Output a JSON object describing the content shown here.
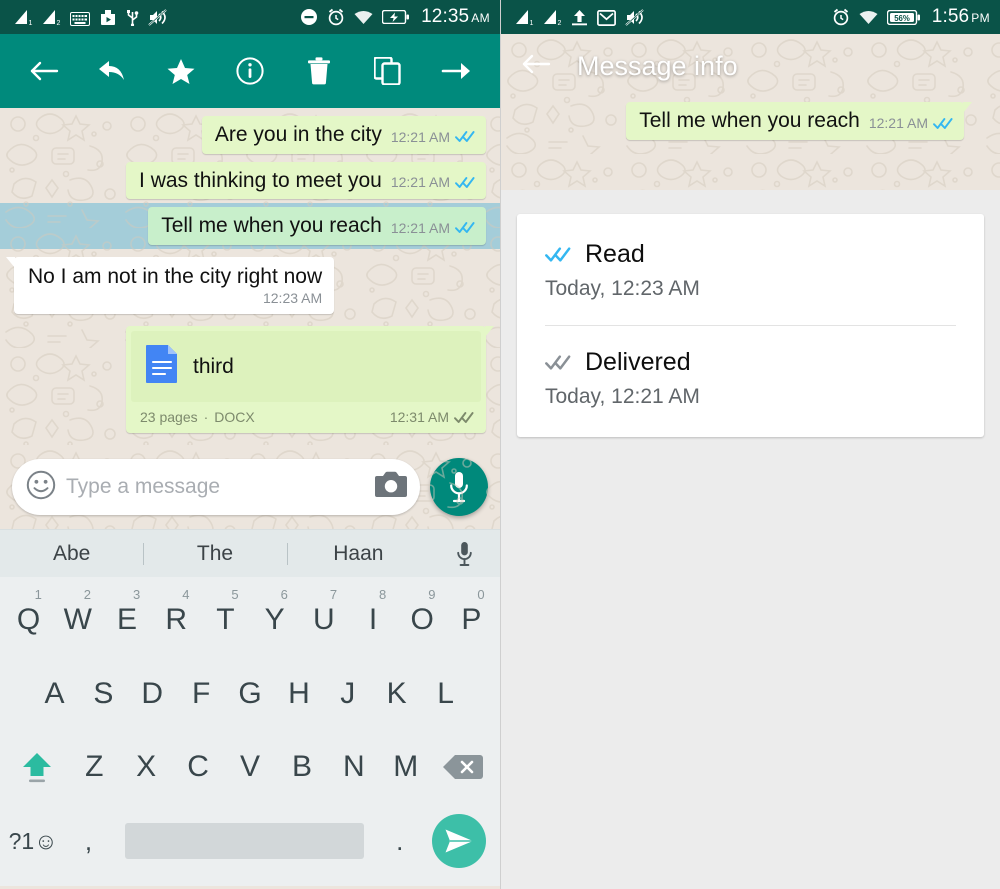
{
  "left_panel": {
    "status_bar": {
      "icons": [
        "signal-1-icon",
        "signal-2-icon",
        "keyboard-icon",
        "play-store-icon",
        "usb-icon",
        "volume-muted-icon"
      ],
      "right_icons": [
        "do-not-disturb-icon",
        "alarm-icon",
        "wifi-icon",
        "battery-charging-icon"
      ],
      "clock": "12:35",
      "ampm": "AM"
    },
    "toolbar": {
      "back_label": "back-arrow",
      "actions": [
        "reply-icon",
        "star-icon",
        "info-icon",
        "delete-icon",
        "copy-icon",
        "forward-icon"
      ]
    },
    "messages": [
      {
        "text": "Are you in the city",
        "time": "12:21 AM",
        "direction": "out",
        "status": "read",
        "selected": false
      },
      {
        "text": "I was thinking to meet you",
        "time": "12:21 AM",
        "direction": "out",
        "status": "read",
        "selected": false
      },
      {
        "text": "Tell me when you reach",
        "time": "12:21 AM",
        "direction": "out",
        "status": "read",
        "selected": true
      },
      {
        "text": "No I am not in the city right now",
        "time": "12:23 AM",
        "direction": "in",
        "status": "none",
        "selected": false
      }
    ],
    "document_message": {
      "file_name": "third",
      "pages": "23 pages",
      "separator": "·",
      "file_type": "DOCX",
      "time": "12:31 AM",
      "status": "delivered",
      "icon": "document-icon"
    },
    "composer": {
      "emoji_icon": "emoji-icon",
      "placeholder": "Type a message",
      "camera_icon": "camera-icon",
      "mic_icon": "microphone-icon"
    },
    "suggestions": {
      "words": [
        "Abe",
        "The",
        "Haan"
      ],
      "mic_icon": "microphone-icon"
    },
    "keyboard": {
      "row1": [
        {
          "key": "Q",
          "num": "1"
        },
        {
          "key": "W",
          "num": "2"
        },
        {
          "key": "E",
          "num": "3"
        },
        {
          "key": "R",
          "num": "4"
        },
        {
          "key": "T",
          "num": "5"
        },
        {
          "key": "Y",
          "num": "6"
        },
        {
          "key": "U",
          "num": "7"
        },
        {
          "key": "I",
          "num": "8"
        },
        {
          "key": "O",
          "num": "9"
        },
        {
          "key": "P",
          "num": "0"
        }
      ],
      "row2": [
        "A",
        "S",
        "D",
        "F",
        "G",
        "H",
        "J",
        "K",
        "L"
      ],
      "row3": [
        "Z",
        "X",
        "C",
        "V",
        "B",
        "N",
        "M"
      ],
      "shift_icon": "shift-icon",
      "backspace_icon": "backspace-icon",
      "symbols_key": "?1☺",
      "comma_key": ",",
      "period_key": ".",
      "space_key": "",
      "send_icon": "send-icon"
    }
  },
  "right_panel": {
    "status_bar": {
      "icons": [
        "signal-1-icon",
        "signal-2-icon",
        "upload-icon",
        "gmail-icon",
        "volume-muted-icon"
      ],
      "right_icons": [
        "alarm-icon",
        "wifi-icon",
        "battery-icon"
      ],
      "battery_percent": "56%",
      "clock": "1:56",
      "ampm": "PM"
    },
    "header": {
      "back_label": "back-arrow",
      "title": "Message info"
    },
    "message": {
      "text": "Tell me when you reach",
      "time": "12:21 AM",
      "status": "read"
    },
    "info_items": [
      {
        "label": "Read",
        "timestamp": "Today, 12:23 AM",
        "tick_state": "read"
      },
      {
        "label": "Delivered",
        "timestamp": "Today, 12:21 AM",
        "tick_state": "delivered"
      }
    ]
  },
  "colors": {
    "status_bar": "#0a5348",
    "toolbar": "#008a7c",
    "wallpaper": "#ece5dd",
    "bubble_out": "#e4f7c7",
    "bubble_out_selected": "#c8efcb",
    "bubble_in": "#ffffff",
    "selection_overlay": "#a8d3e0",
    "tick_read": "#34b7f1",
    "tick_delivered": "#8a9096",
    "keyboard_bg": "#eceff0",
    "accent_send": "#3dbfa8",
    "doc_icon": "#4285f4"
  }
}
